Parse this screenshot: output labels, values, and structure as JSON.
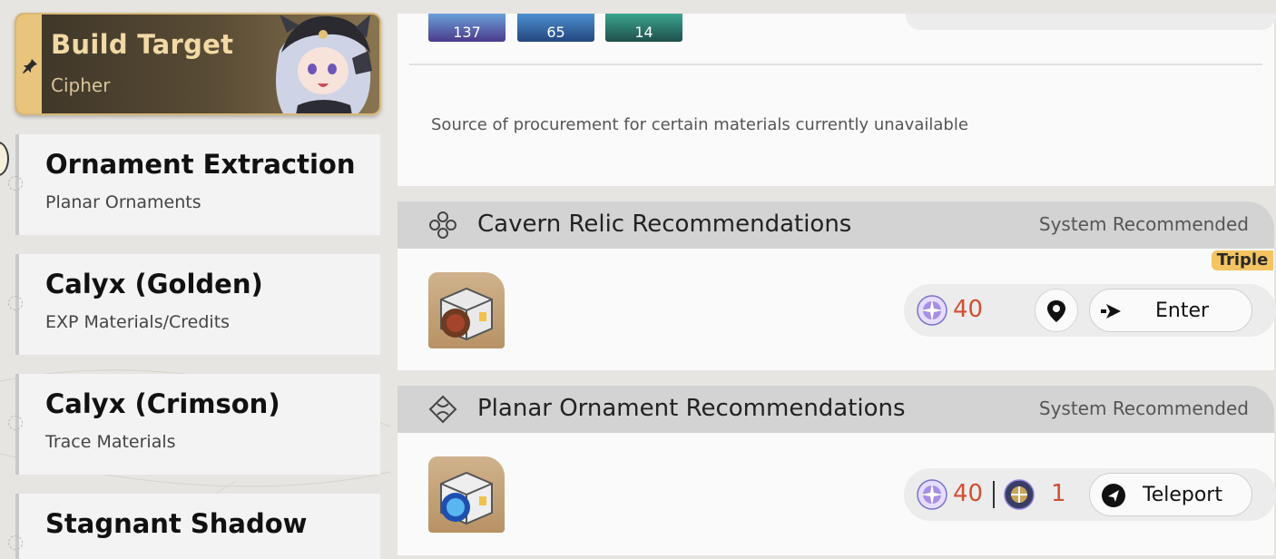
{
  "build_target": {
    "title": "Build Target",
    "subtitle": "Cipher",
    "icon": "pin-icon"
  },
  "sidebar": {
    "items": [
      {
        "name": "Ornament Extraction",
        "subtitle": "Planar Ornaments"
      },
      {
        "name": "Calyx (Golden)",
        "subtitle": "EXP Materials/Credits"
      },
      {
        "name": "Calyx (Crimson)",
        "subtitle": "Trace Materials"
      },
      {
        "name": "Stagnant Shadow",
        "subtitle": ""
      }
    ]
  },
  "materials": {
    "counts": [
      "137",
      "65",
      "14"
    ]
  },
  "notice": {
    "text": "Source of procurement for certain materials currently unavailable"
  },
  "cavern": {
    "title": "Cavern Relic Recommendations",
    "tag": "System Recommended",
    "badge": "Triple",
    "cost": "40",
    "enter_label": "Enter",
    "icons": [
      "cavern-relic-icon",
      "trailblaze-power-icon",
      "location-pin-icon",
      "enter-arrow-icon"
    ]
  },
  "planar": {
    "title": "Planar Ornament Recommendations",
    "tag": "System Recommended",
    "cost": "40",
    "fuel_count": "1",
    "teleport_label": "Teleport",
    "icons": [
      "planar-ornament-icon",
      "trailblaze-power-icon",
      "fuel-icon",
      "teleport-icon"
    ]
  },
  "colors": {
    "accent_gold": "#e9c47d",
    "cost_red": "#cf5034",
    "badge_yellow": "#f3c461"
  }
}
